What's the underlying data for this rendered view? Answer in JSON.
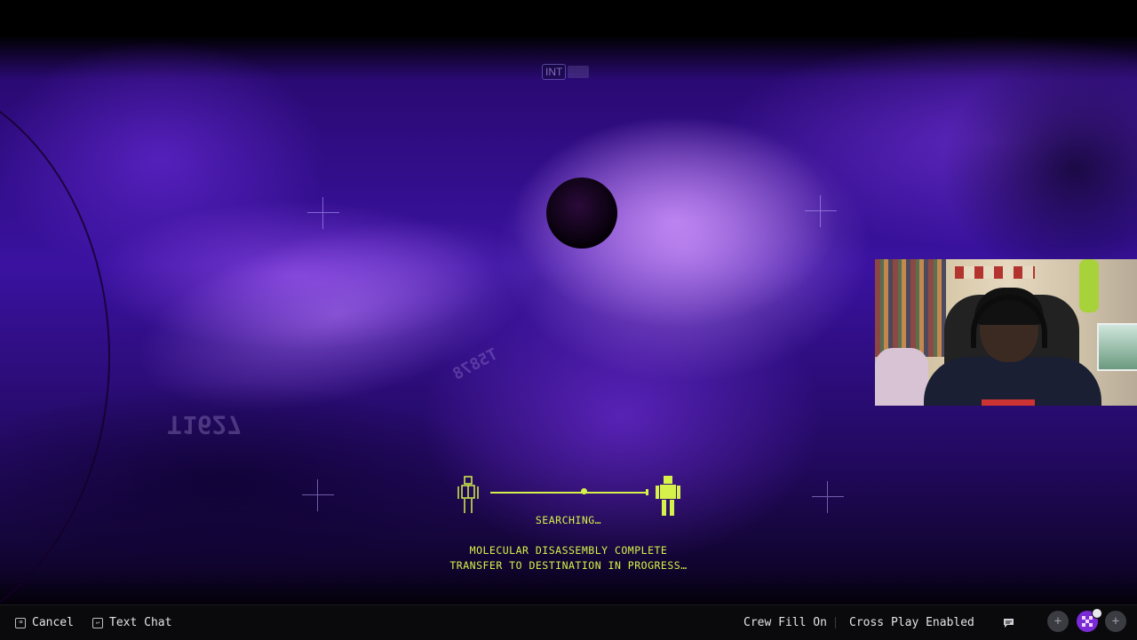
{
  "hud": {
    "badge_label": "INT",
    "status_searching": "SEARCHING…",
    "message_line1": "MOLECULAR DISASSEMBLY COMPLETE",
    "message_line2": "TRANSFER TO DESTINATION IN PROGRESS…",
    "transfer_progress_fraction": 0.6
  },
  "scene": {
    "scrawl_1": "T1627",
    "scrawl_2": "T5878"
  },
  "bottom_bar": {
    "cancel_label": "Cancel",
    "text_chat_label": "Text Chat",
    "crew_fill_label": "Crew Fill On",
    "cross_play_label": "Cross Play Enabled"
  },
  "colors": {
    "hud_accent": "#d6f24a",
    "scene_purple": "#3a12a0",
    "bar_bg": "#0a0a0c"
  },
  "icons": {
    "cancel_key": "keyboard-key-icon",
    "text_chat_key": "enter-key-icon",
    "chat": "chat-bubble-icon",
    "left_button": "plus-icon",
    "party": "party-avatar-icon",
    "right_button": "plus-icon"
  }
}
